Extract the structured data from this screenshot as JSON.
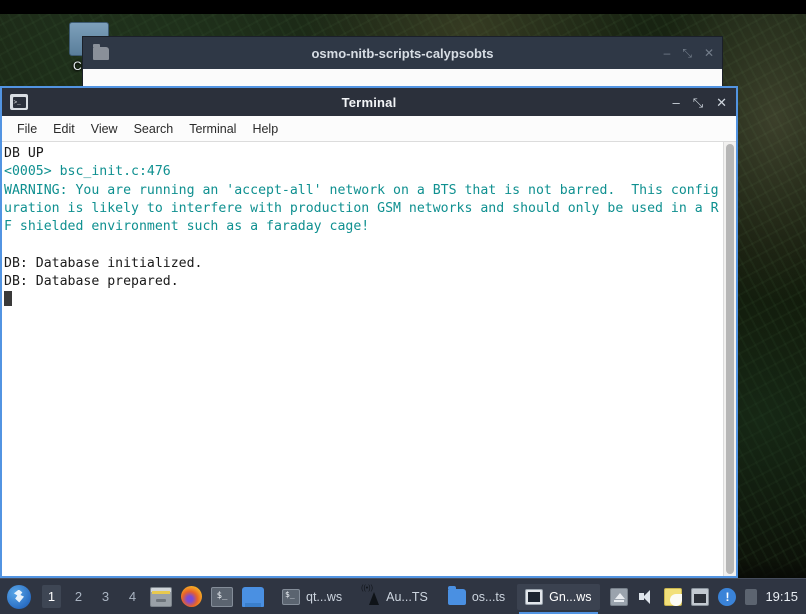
{
  "desktop": {
    "icon": {
      "name": "computer-icon",
      "label": "Comp"
    }
  },
  "background_window": {
    "title": "osmo-nitb-scripts-calypsobts",
    "icon": "folder-icon",
    "controls": {
      "minimize": "–",
      "maximize": "⤡",
      "close": "✕"
    }
  },
  "terminal": {
    "title": "Terminal",
    "icon": "terminal-icon",
    "controls": {
      "minimize": "–",
      "maximize": "⤡",
      "close": "✕"
    },
    "menu": [
      {
        "label": "File"
      },
      {
        "label": "Edit"
      },
      {
        "label": "View"
      },
      {
        "label": "Search"
      },
      {
        "label": "Terminal"
      },
      {
        "label": "Help"
      }
    ],
    "output": {
      "line_db_up": "DB UP",
      "line_bsc": "<0005> bsc_init.c:476",
      "line_warning": "WARNING: You are running an 'accept-all' network on a BTS that is not barred.  This configuration is likely to interfere with production GSM networks and should only be used in a RF shielded environment such as a faraday cage!",
      "line_db_init": "DB: Database initialized.",
      "line_db_prep": "DB: Database prepared."
    },
    "colors": {
      "warning_text": "#0f9090",
      "normal_text": "#1a1a1a",
      "background": "#ffffff",
      "border": "#5294e2"
    }
  },
  "taskbar": {
    "menu_icon": "xfce-mouse-icon",
    "workspaces": [
      {
        "label": "1",
        "active": true
      },
      {
        "label": "2",
        "active": false
      },
      {
        "label": "3",
        "active": false
      },
      {
        "label": "4",
        "active": false
      }
    ],
    "launchers": [
      {
        "name": "file-drawer-icon"
      },
      {
        "name": "firefox-icon"
      },
      {
        "name": "terminal-icon"
      },
      {
        "name": "blue-app-icon"
      }
    ],
    "tasks": [
      {
        "label": "qt...ws",
        "icon": "terminal-icon",
        "active": false
      },
      {
        "label": "Au...TS",
        "icon": "antenna-icon",
        "active": false
      },
      {
        "label": "os...ts",
        "icon": "folder-icon",
        "active": false
      },
      {
        "label": "Gn...ws",
        "icon": "terminal-icon",
        "active": true
      }
    ],
    "tray": [
      {
        "name": "eject-icon"
      },
      {
        "name": "volume-icon"
      },
      {
        "name": "clipboard-icon"
      },
      {
        "name": "network-icon"
      },
      {
        "name": "alert-icon",
        "glyph": "!"
      },
      {
        "name": "tray-box-icon"
      }
    ],
    "clock": "19:15"
  }
}
